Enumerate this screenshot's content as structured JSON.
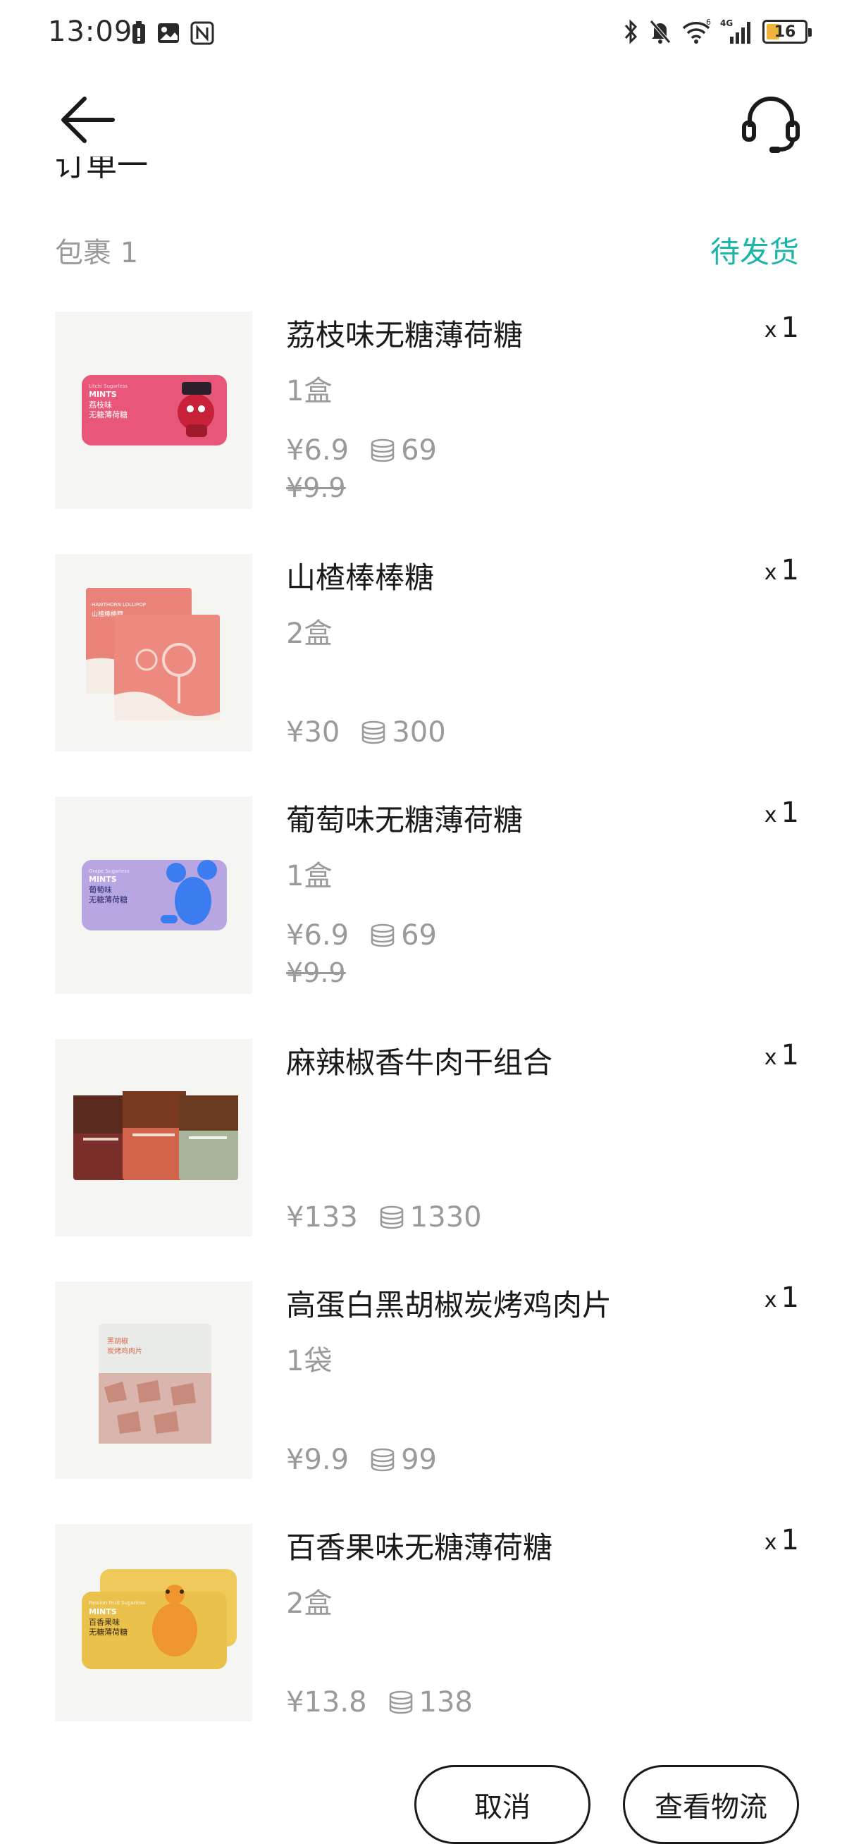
{
  "status_bar": {
    "time": "13:09",
    "battery": "16",
    "network": "4G",
    "wifi_badge": "6",
    "icons": [
      "battery-saver-icon",
      "image-icon",
      "nfc-icon",
      "bluetooth-icon",
      "mute-icon",
      "wifi-icon",
      "signal-icon",
      "battery-icon"
    ]
  },
  "header": {
    "back_icon": "back-arrow-icon",
    "service_icon": "headset-icon",
    "order_title": "订单一"
  },
  "package": {
    "label": "包裹 1",
    "status": "待发货",
    "status_color": "#1bb5a8"
  },
  "items": [
    {
      "name": "荔枝味无糖薄荷糖",
      "qty_prefix": "x",
      "qty": "1",
      "spec": "1盒",
      "price": "¥6.9",
      "coins": "69",
      "old_price": "¥9.9",
      "thumb": {
        "brand": "Litchi Sugarless",
        "title": "MINTS",
        "cn1": "荔枝味",
        "cn2": "无糖薄荷糖",
        "color": "#e8577a"
      }
    },
    {
      "name": "山楂棒棒糖",
      "qty_prefix": "x",
      "qty": "1",
      "spec": "2盒",
      "price": "¥30",
      "coins": "300",
      "old_price": "",
      "thumb": {
        "brand": "HAWTHORN LOLLIPOP",
        "title": "",
        "cn1": "山楂棒棒糖",
        "cn2": "",
        "color": "#e98279"
      }
    },
    {
      "name": "葡萄味无糖薄荷糖",
      "qty_prefix": "x",
      "qty": "1",
      "spec": "1盒",
      "price": "¥6.9",
      "coins": "69",
      "old_price": "¥9.9",
      "thumb": {
        "brand": "Grape Sugarless",
        "title": "MINTS",
        "cn1": "葡萄味",
        "cn2": "无糖薄荷糖",
        "color": "#b8a6e2"
      }
    },
    {
      "name": "麻辣椒香牛肉干组合",
      "qty_prefix": "x",
      "qty": "1",
      "spec": "",
      "price": "¥133",
      "coins": "1330",
      "old_price": "",
      "thumb": {
        "brand": "",
        "title": "",
        "cn1": "",
        "cn2": "",
        "color": "#b8543c"
      }
    },
    {
      "name": "高蛋白黑胡椒炭烤鸡肉片",
      "qty_prefix": "x",
      "qty": "1",
      "spec": "1袋",
      "price": "¥9.9",
      "coins": "99",
      "old_price": "",
      "thumb": {
        "brand": "",
        "title": "",
        "cn1": "黑胡椒",
        "cn2": "炭烤鸡肉片",
        "color": "#e9ebe8"
      }
    },
    {
      "name": "百香果味无糖薄荷糖",
      "qty_prefix": "x",
      "qty": "1",
      "spec": "2盒",
      "price": "¥13.8",
      "coins": "138",
      "old_price": "",
      "thumb": {
        "brand": "Passion Fruit Sugarless",
        "title": "MINTS",
        "cn1": "百香果味",
        "cn2": "无糖薄荷糖",
        "color": "#e9c14c"
      }
    }
  ],
  "actions": {
    "cancel": "取消",
    "logistics": "查看物流"
  }
}
